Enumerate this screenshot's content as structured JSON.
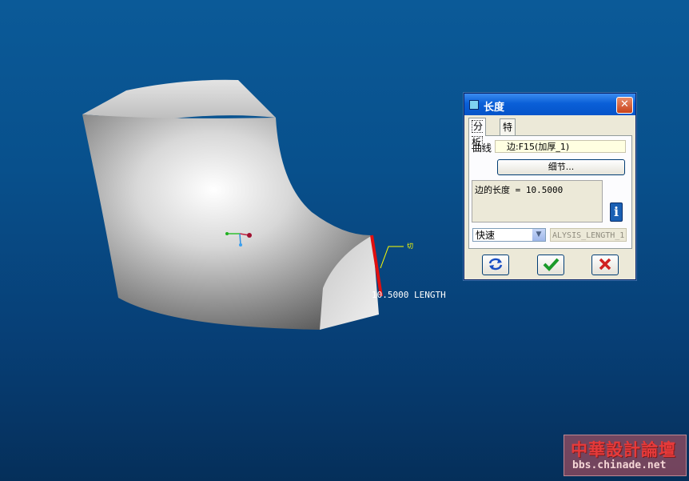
{
  "viewport": {
    "length_annotation": "10.5000 LENGTH",
    "edge_tag": "切"
  },
  "dialog": {
    "title": "长度",
    "close_glyph": "✕",
    "tabs": [
      {
        "label": "分析",
        "active": true
      },
      {
        "label": "特征",
        "active": false
      }
    ],
    "curve_label": "曲线",
    "curve_value": "边:F15(加厚_1)",
    "detail_button": "细节...",
    "result_text": "边的长度  = 10.5000",
    "info_icon": "i",
    "mode_select": "快速",
    "param_name": "ALYSIS_LENGTH_1",
    "buttons": {
      "repeat": "repeat-icon",
      "ok": "check-icon",
      "cancel": "x-icon"
    }
  },
  "watermark": {
    "title": "中華設計論壇",
    "url": "bbs.chinade.net"
  },
  "colors": {
    "background": "#08508c",
    "selected_edge": "#e01010",
    "dialog_title": "#0454c9"
  }
}
